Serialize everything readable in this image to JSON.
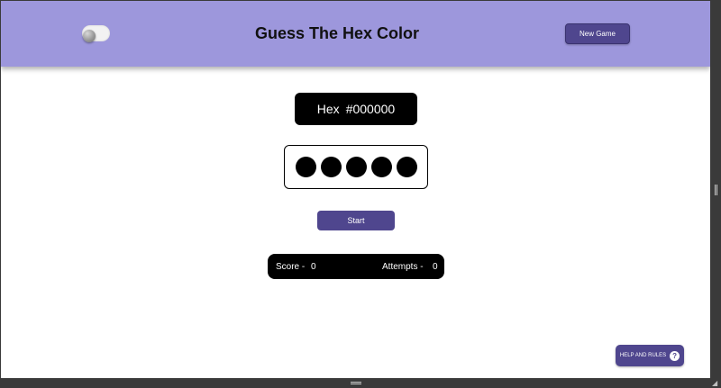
{
  "header": {
    "title": "Guess The Hex Color",
    "new_game_label": "New Game",
    "theme_toggle_on": false
  },
  "main": {
    "hex_label": "Hex",
    "hex_value": "#000000",
    "circles": [
      "#000000",
      "#000000",
      "#000000",
      "#000000",
      "#000000"
    ],
    "start_label": "Start"
  },
  "score": {
    "score_label": "Score -",
    "score_value": "0",
    "attempts_label": "Attempts -",
    "attempts_value": "0"
  },
  "help": {
    "label": "HELP AND RULES",
    "icon_glyph": "?"
  },
  "colors": {
    "header_bg": "#9d97dc",
    "accent": "#4f468e",
    "panel": "#000000"
  }
}
